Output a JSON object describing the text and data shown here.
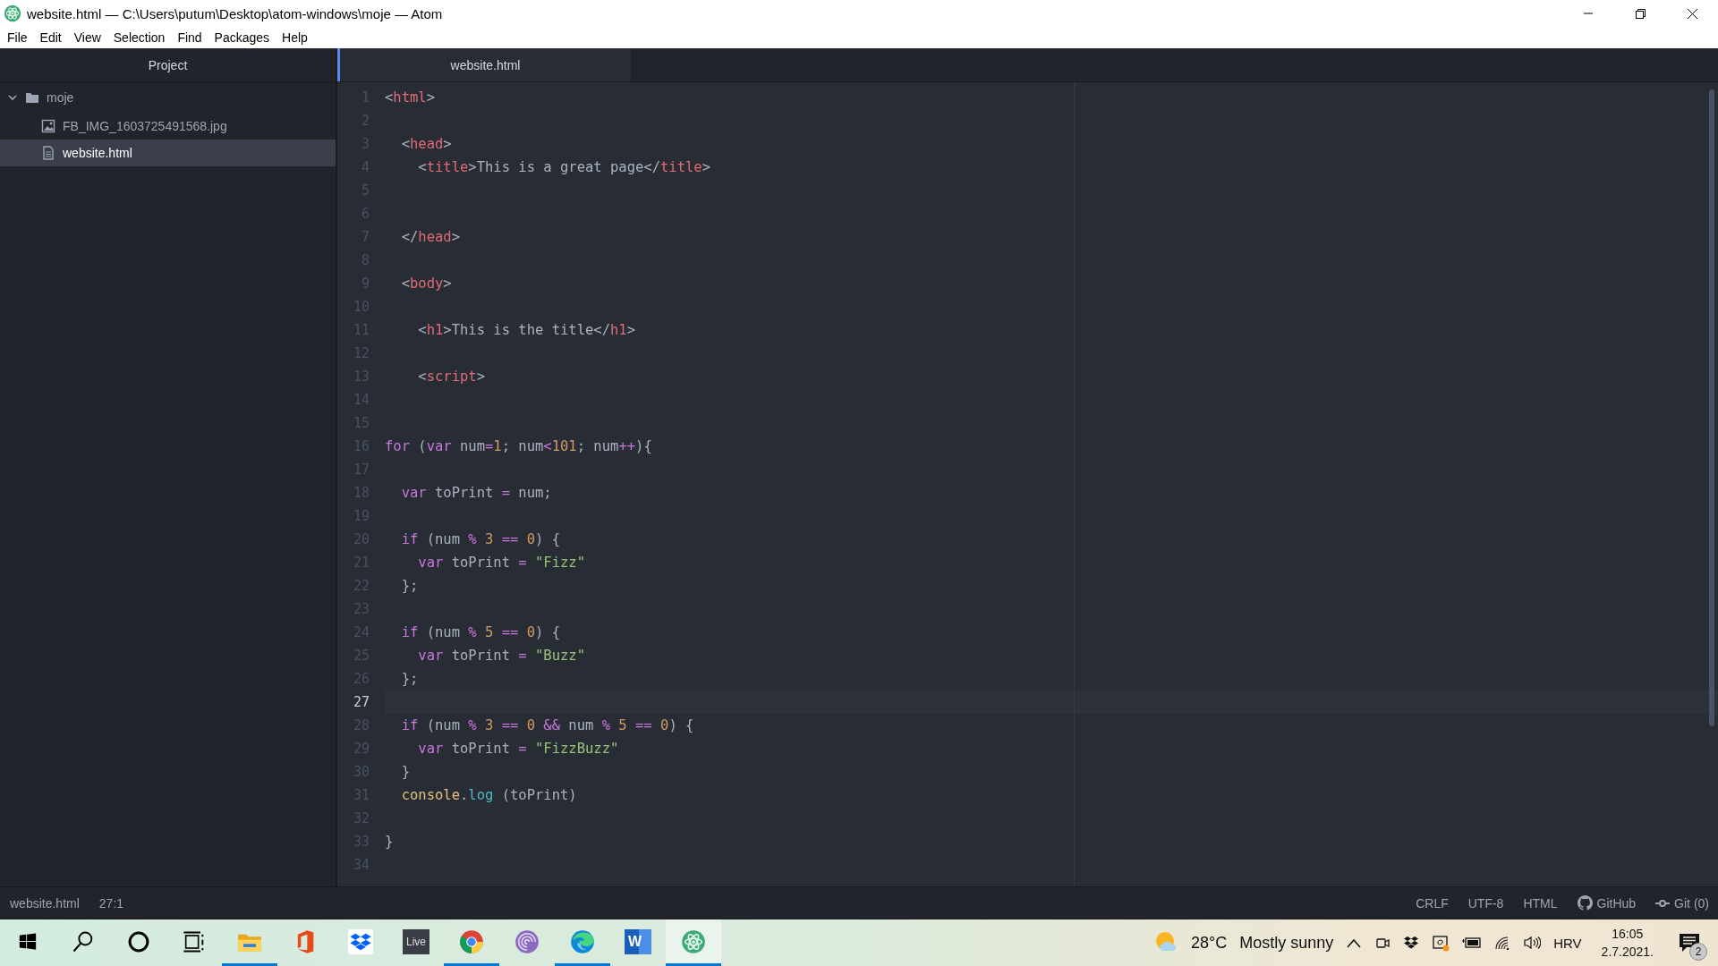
{
  "window": {
    "title": "website.html — C:\\Users\\putum\\Desktop\\atom-windows\\moje — Atom"
  },
  "menu": [
    "File",
    "Edit",
    "View",
    "Selection",
    "Find",
    "Packages",
    "Help"
  ],
  "project_panel": {
    "title": "Project",
    "tree": [
      {
        "label": "moje",
        "kind": "folder",
        "expanded": true,
        "selected": false,
        "children": [
          {
            "label": "FB_IMG_1603725491568.jpg",
            "kind": "image",
            "selected": false
          },
          {
            "label": "website.html",
            "kind": "file",
            "selected": true
          }
        ]
      }
    ]
  },
  "tabs": [
    {
      "label": "website.html",
      "selected": true
    }
  ],
  "editor": {
    "lines": [
      {
        "number": "1",
        "current": false,
        "tokens": [
          {
            "kind": "plain",
            "text": "<"
          },
          {
            "kind": "tag",
            "text": "html"
          },
          {
            "kind": "plain",
            "text": ">"
          }
        ]
      },
      {
        "number": "2",
        "current": false
      },
      {
        "number": "3",
        "current": false,
        "tokens": [
          {
            "kind": "plain",
            "text": "  <"
          },
          {
            "kind": "tag",
            "text": "head"
          },
          {
            "kind": "plain",
            "text": ">"
          }
        ]
      },
      {
        "number": "4",
        "current": false,
        "tokens": [
          {
            "kind": "plain",
            "text": "    <"
          },
          {
            "kind": "tag",
            "text": "title"
          },
          {
            "kind": "plain",
            "text": ">This is a great page</"
          },
          {
            "kind": "tag",
            "text": "title"
          },
          {
            "kind": "plain",
            "text": ">"
          }
        ]
      },
      {
        "number": "5",
        "current": false
      },
      {
        "number": "6",
        "current": false
      },
      {
        "number": "7",
        "current": false,
        "tokens": [
          {
            "kind": "plain",
            "text": "  </"
          },
          {
            "kind": "tag",
            "text": "head"
          },
          {
            "kind": "plain",
            "text": ">"
          }
        ]
      },
      {
        "number": "8",
        "current": false
      },
      {
        "number": "9",
        "current": false,
        "tokens": [
          {
            "kind": "plain",
            "text": "  <"
          },
          {
            "kind": "tag",
            "text": "body"
          },
          {
            "kind": "plain",
            "text": ">"
          }
        ]
      },
      {
        "number": "10",
        "current": false
      },
      {
        "number": "11",
        "current": false,
        "tokens": [
          {
            "kind": "plain",
            "text": "    <"
          },
          {
            "kind": "tag",
            "text": "h1"
          },
          {
            "kind": "plain",
            "text": ">This is the title</"
          },
          {
            "kind": "tag",
            "text": "h1"
          },
          {
            "kind": "plain",
            "text": ">"
          }
        ]
      },
      {
        "number": "12",
        "current": false
      },
      {
        "number": "13",
        "current": false,
        "tokens": [
          {
            "kind": "plain",
            "text": "    <"
          },
          {
            "kind": "tag",
            "text": "script"
          },
          {
            "kind": "plain",
            "text": ">"
          }
        ]
      },
      {
        "number": "14",
        "current": false
      },
      {
        "number": "15",
        "current": false
      },
      {
        "number": "16",
        "current": false,
        "tokens": [
          {
            "kind": "keyword",
            "text": "for"
          },
          {
            "kind": "plain",
            "text": " ("
          },
          {
            "kind": "keyword",
            "text": "var"
          },
          {
            "kind": "plain",
            "text": " num"
          },
          {
            "kind": "operator",
            "text": "="
          },
          {
            "kind": "number",
            "text": "1"
          },
          {
            "kind": "plain",
            "text": "; num"
          },
          {
            "kind": "operator",
            "text": "<"
          },
          {
            "kind": "number",
            "text": "101"
          },
          {
            "kind": "plain",
            "text": "; num"
          },
          {
            "kind": "operator",
            "text": "++"
          },
          {
            "kind": "plain",
            "text": "){"
          }
        ]
      },
      {
        "number": "17",
        "current": false
      },
      {
        "number": "18",
        "current": false,
        "tokens": [
          {
            "kind": "keyword",
            "text": "  var"
          },
          {
            "kind": "plain",
            "text": " toPrint "
          },
          {
            "kind": "operator",
            "text": "="
          },
          {
            "kind": "plain",
            "text": " num;"
          }
        ]
      },
      {
        "number": "19",
        "current": false
      },
      {
        "number": "20",
        "current": false,
        "tokens": [
          {
            "kind": "keyword",
            "text": "  if"
          },
          {
            "kind": "plain",
            "text": " (num "
          },
          {
            "kind": "operator",
            "text": "%"
          },
          {
            "kind": "number",
            "text": " 3 "
          },
          {
            "kind": "operator",
            "text": "=="
          },
          {
            "kind": "number",
            "text": " 0"
          },
          {
            "kind": "plain",
            "text": ") {"
          }
        ]
      },
      {
        "number": "21",
        "current": false,
        "tokens": [
          {
            "kind": "keyword",
            "text": "    var"
          },
          {
            "kind": "plain",
            "text": " toPrint "
          },
          {
            "kind": "operator",
            "text": "="
          },
          {
            "kind": "string",
            "text": " \"Fizz\""
          }
        ]
      },
      {
        "number": "22",
        "current": false,
        "tokens": [
          {
            "kind": "plain",
            "text": "  };"
          }
        ]
      },
      {
        "number": "23",
        "current": false
      },
      {
        "number": "24",
        "current": false,
        "tokens": [
          {
            "kind": "keyword",
            "text": "  if"
          },
          {
            "kind": "plain",
            "text": " (num "
          },
          {
            "kind": "operator",
            "text": "%"
          },
          {
            "kind": "number",
            "text": " 5 "
          },
          {
            "kind": "operator",
            "text": "=="
          },
          {
            "kind": "number",
            "text": " 0"
          },
          {
            "kind": "plain",
            "text": ") {"
          }
        ]
      },
      {
        "number": "25",
        "current": false,
        "tokens": [
          {
            "kind": "keyword",
            "text": "    var"
          },
          {
            "kind": "plain",
            "text": " toPrint "
          },
          {
            "kind": "operator",
            "text": "="
          },
          {
            "kind": "string",
            "text": " \"Buzz\""
          }
        ]
      },
      {
        "number": "26",
        "current": false,
        "tokens": [
          {
            "kind": "plain",
            "text": "  };"
          }
        ]
      },
      {
        "number": "27",
        "current": true
      },
      {
        "number": "28",
        "current": false,
        "tokens": [
          {
            "kind": "keyword",
            "text": "  if"
          },
          {
            "kind": "plain",
            "text": " (num "
          },
          {
            "kind": "operator",
            "text": "%"
          },
          {
            "kind": "number",
            "text": " 3 "
          },
          {
            "kind": "operator",
            "text": "=="
          },
          {
            "kind": "number",
            "text": " 0 "
          },
          {
            "kind": "operator",
            "text": "&&"
          },
          {
            "kind": "plain",
            "text": " num "
          },
          {
            "kind": "operator",
            "text": "%"
          },
          {
            "kind": "number",
            "text": " 5 "
          },
          {
            "kind": "operator",
            "text": "=="
          },
          {
            "kind": "number",
            "text": " 0"
          },
          {
            "kind": "plain",
            "text": ") {"
          }
        ]
      },
      {
        "number": "29",
        "current": false,
        "tokens": [
          {
            "kind": "keyword",
            "text": "    var"
          },
          {
            "kind": "plain",
            "text": " toPrint "
          },
          {
            "kind": "operator",
            "text": "="
          },
          {
            "kind": "string",
            "text": " \"FizzBuzz\""
          }
        ]
      },
      {
        "number": "30",
        "current": false,
        "tokens": [
          {
            "kind": "plain",
            "text": "  }"
          }
        ]
      },
      {
        "number": "31",
        "current": false,
        "tokens": [
          {
            "kind": "builtin",
            "text": "  console"
          },
          {
            "kind": "plain",
            "text": "."
          },
          {
            "kind": "method",
            "text": "log"
          },
          {
            "kind": "plain",
            "text": " (toPrint)"
          }
        ]
      },
      {
        "number": "32",
        "current": false
      },
      {
        "number": "33",
        "current": false,
        "tokens": [
          {
            "kind": "plain",
            "text": "}"
          }
        ]
      },
      {
        "number": "34",
        "current": false
      }
    ]
  },
  "status_bar": {
    "left": [
      "website.html",
      "27:1"
    ],
    "right": [
      {
        "label": "CRLF",
        "kind": "text"
      },
      {
        "label": "UTF-8",
        "kind": "text"
      },
      {
        "label": "HTML",
        "kind": "text"
      },
      {
        "label": "GitHub",
        "kind": "github"
      },
      {
        "label": "Git (0)",
        "kind": "git"
      }
    ]
  },
  "taskbar": {
    "apps": [
      {
        "kind": "start",
        "running": false,
        "selected": false
      },
      {
        "kind": "search",
        "running": false,
        "selected": false
      },
      {
        "kind": "cortana",
        "running": false,
        "selected": false
      },
      {
        "kind": "taskview",
        "running": false,
        "selected": false
      },
      {
        "kind": "explorer",
        "running": true,
        "selected": false
      },
      {
        "kind": "office",
        "running": false,
        "selected": false
      },
      {
        "kind": "dropbox",
        "running": false,
        "selected": false
      },
      {
        "kind": "live",
        "label": "Live",
        "running": false,
        "selected": false
      },
      {
        "kind": "chrome",
        "running": true,
        "selected": false
      },
      {
        "kind": "torrent",
        "running": false,
        "selected": false
      },
      {
        "kind": "edge",
        "running": true,
        "selected": false
      },
      {
        "kind": "word",
        "label": "W",
        "running": false,
        "selected": false
      },
      {
        "kind": "atom",
        "running": true,
        "selected": true
      }
    ],
    "weather": {
      "temperature": "28°C",
      "condition": "Mostly sunny"
    },
    "language": "HRV",
    "time": "16:05",
    "date": "2.7.2021.",
    "notifications": "2"
  }
}
